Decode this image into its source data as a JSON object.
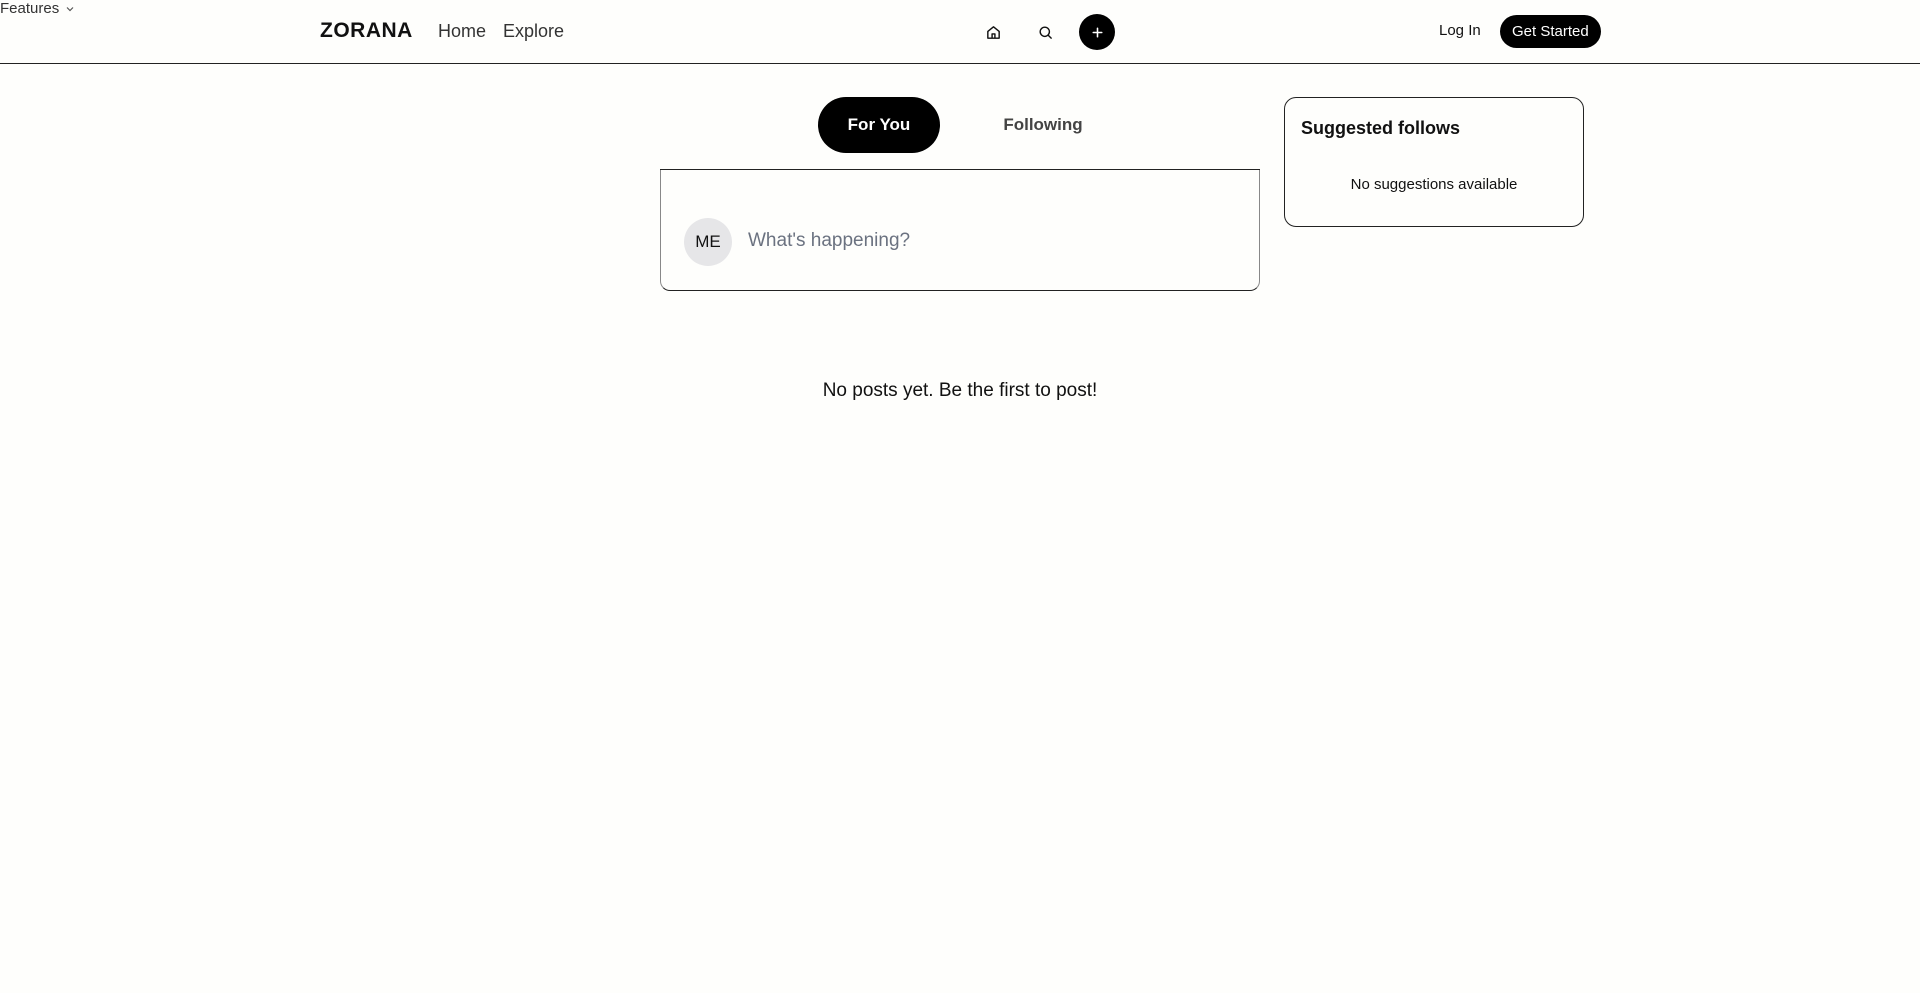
{
  "header": {
    "logo": "ZORANA",
    "nav": {
      "home": "Home",
      "explore": "Explore",
      "features": "Features"
    },
    "icons": {
      "home": "home-icon",
      "search": "search-icon",
      "create": "plus-icon"
    },
    "login": "Log In",
    "get_started": "Get Started"
  },
  "feed": {
    "tabs": {
      "for_you": "For You",
      "following": "Following"
    },
    "active_tab": "For You",
    "composer": {
      "avatar_initials": "ME",
      "placeholder": "What's happening?"
    },
    "empty_message": "No posts yet. Be the first to post!"
  },
  "sidebar": {
    "suggested_title": "Suggested follows",
    "empty_message": "No suggestions available"
  },
  "colors": {
    "accent": "#000000",
    "background": "#fefefc",
    "placeholder": "#6b7280"
  }
}
